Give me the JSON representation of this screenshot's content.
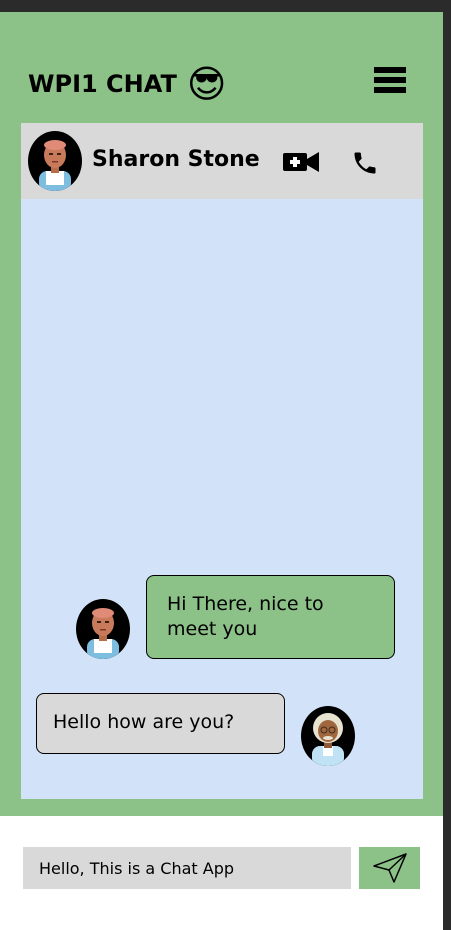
{
  "header": {
    "title": "WPI1 CHAT",
    "title_emoji": "😎",
    "menu_icon": "hamburger-menu-icon"
  },
  "chat_header": {
    "contact_name": "Sharon Stone",
    "video_icon": "video-call-icon",
    "phone_icon": "phone-icon"
  },
  "messages": [
    {
      "side": "sent",
      "text": "Hi There, nice to meet you",
      "avatar": "avatar-sharon"
    },
    {
      "side": "received",
      "text": "Hello how are you?",
      "avatar": "avatar-elder"
    }
  ],
  "composer": {
    "value": "Hello, This is a Chat App",
    "send_icon": "paper-plane-send-icon"
  },
  "colors": {
    "green": "#8cc188",
    "panel_blue": "#d2e2f8",
    "gray": "#d9d9d9"
  }
}
